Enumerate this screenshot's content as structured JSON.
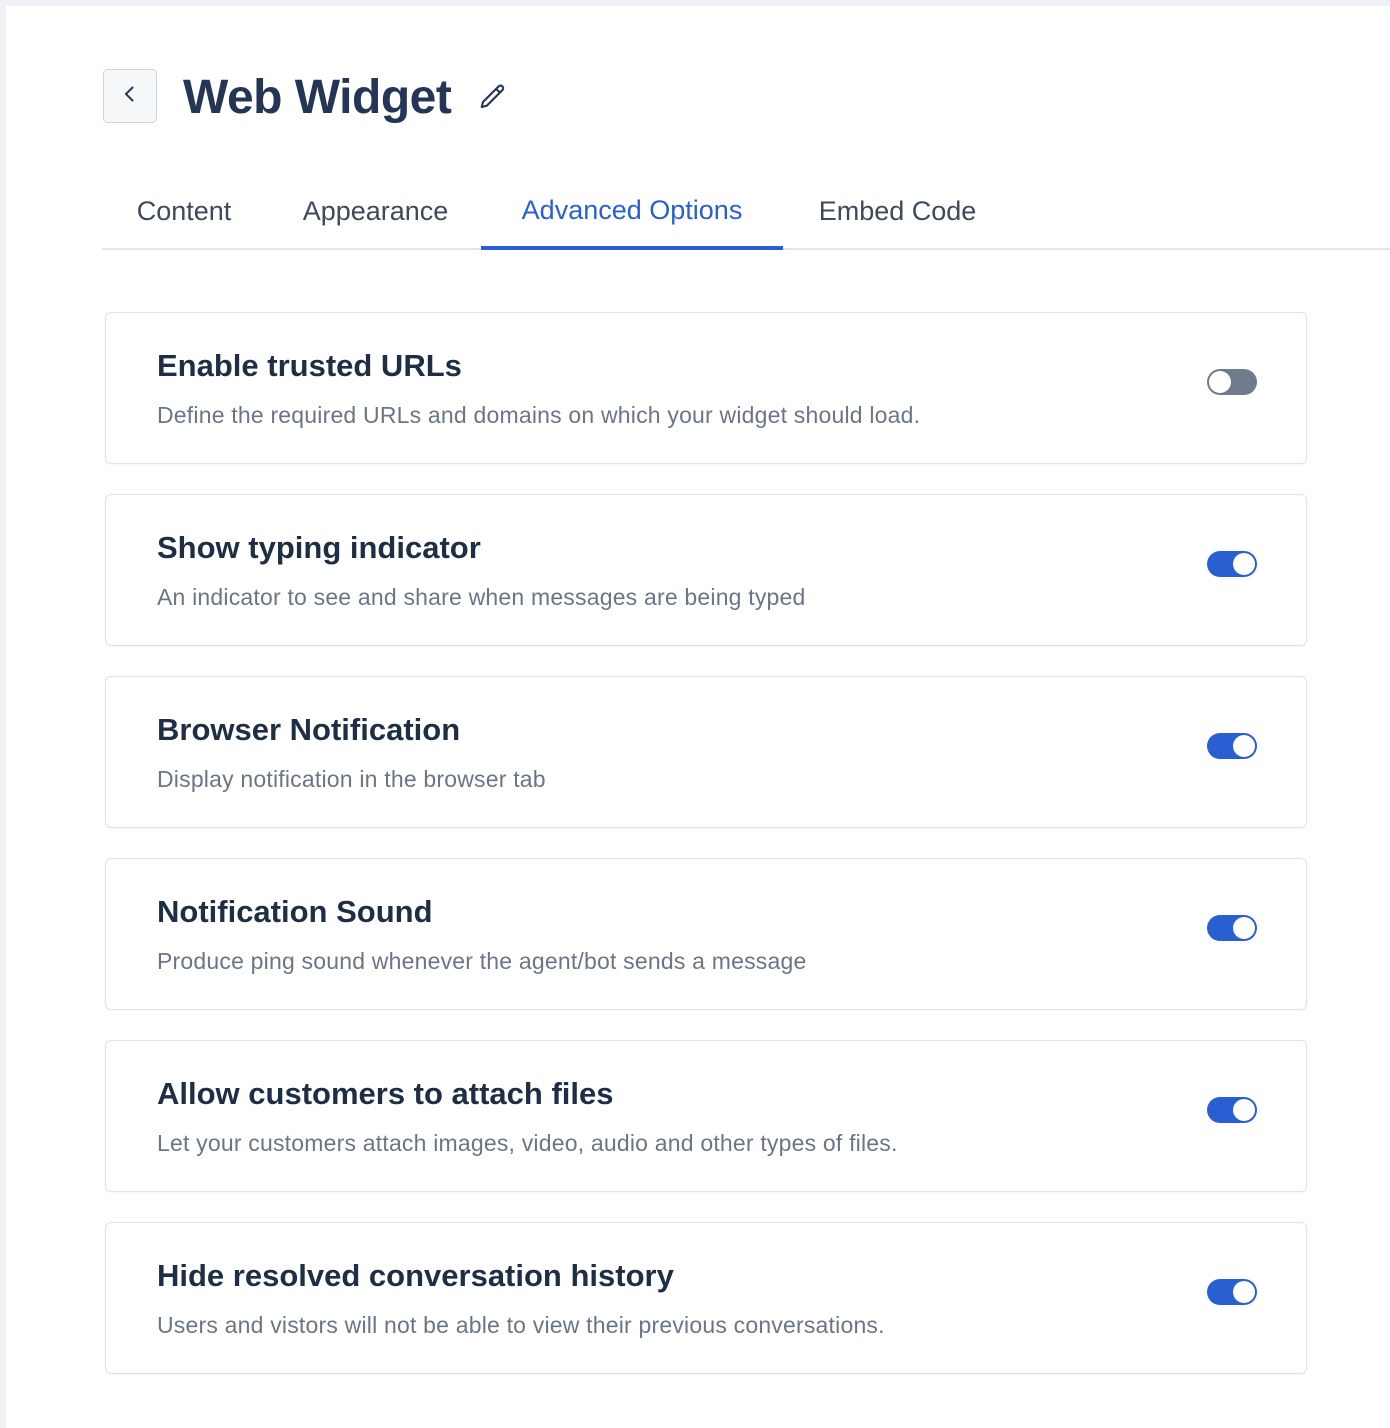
{
  "header": {
    "title": "Web Widget",
    "back_icon": "chevron-left-icon",
    "edit_icon": "pencil-icon"
  },
  "tabs": [
    {
      "label": "Content",
      "active": false
    },
    {
      "label": "Appearance",
      "active": false
    },
    {
      "label": "Advanced Options",
      "active": true
    },
    {
      "label": "Embed Code",
      "active": false
    }
  ],
  "settings": [
    {
      "title": "Enable trusted URLs",
      "description": "Define the required URLs and domains on which your widget should load.",
      "enabled": false
    },
    {
      "title": "Show typing indicator",
      "description": "An indicator to see and share when messages are being typed",
      "enabled": true
    },
    {
      "title": "Browser Notification",
      "description": "Display notification in the browser tab",
      "enabled": true
    },
    {
      "title": "Notification Sound",
      "description": "Produce ping sound whenever the agent/bot sends a message",
      "enabled": true
    },
    {
      "title": "Allow customers to attach files",
      "description": "Let your customers attach images, video, audio and other types of files.",
      "enabled": true
    },
    {
      "title": "Hide resolved conversation history",
      "description": "Users and vistors will not be able to view their previous conversations.",
      "enabled": true
    }
  ],
  "colors": {
    "accent": "#2a5fd4",
    "toggle_off": "#6e7c8e",
    "title": "#243656",
    "description": "#6a7685"
  }
}
